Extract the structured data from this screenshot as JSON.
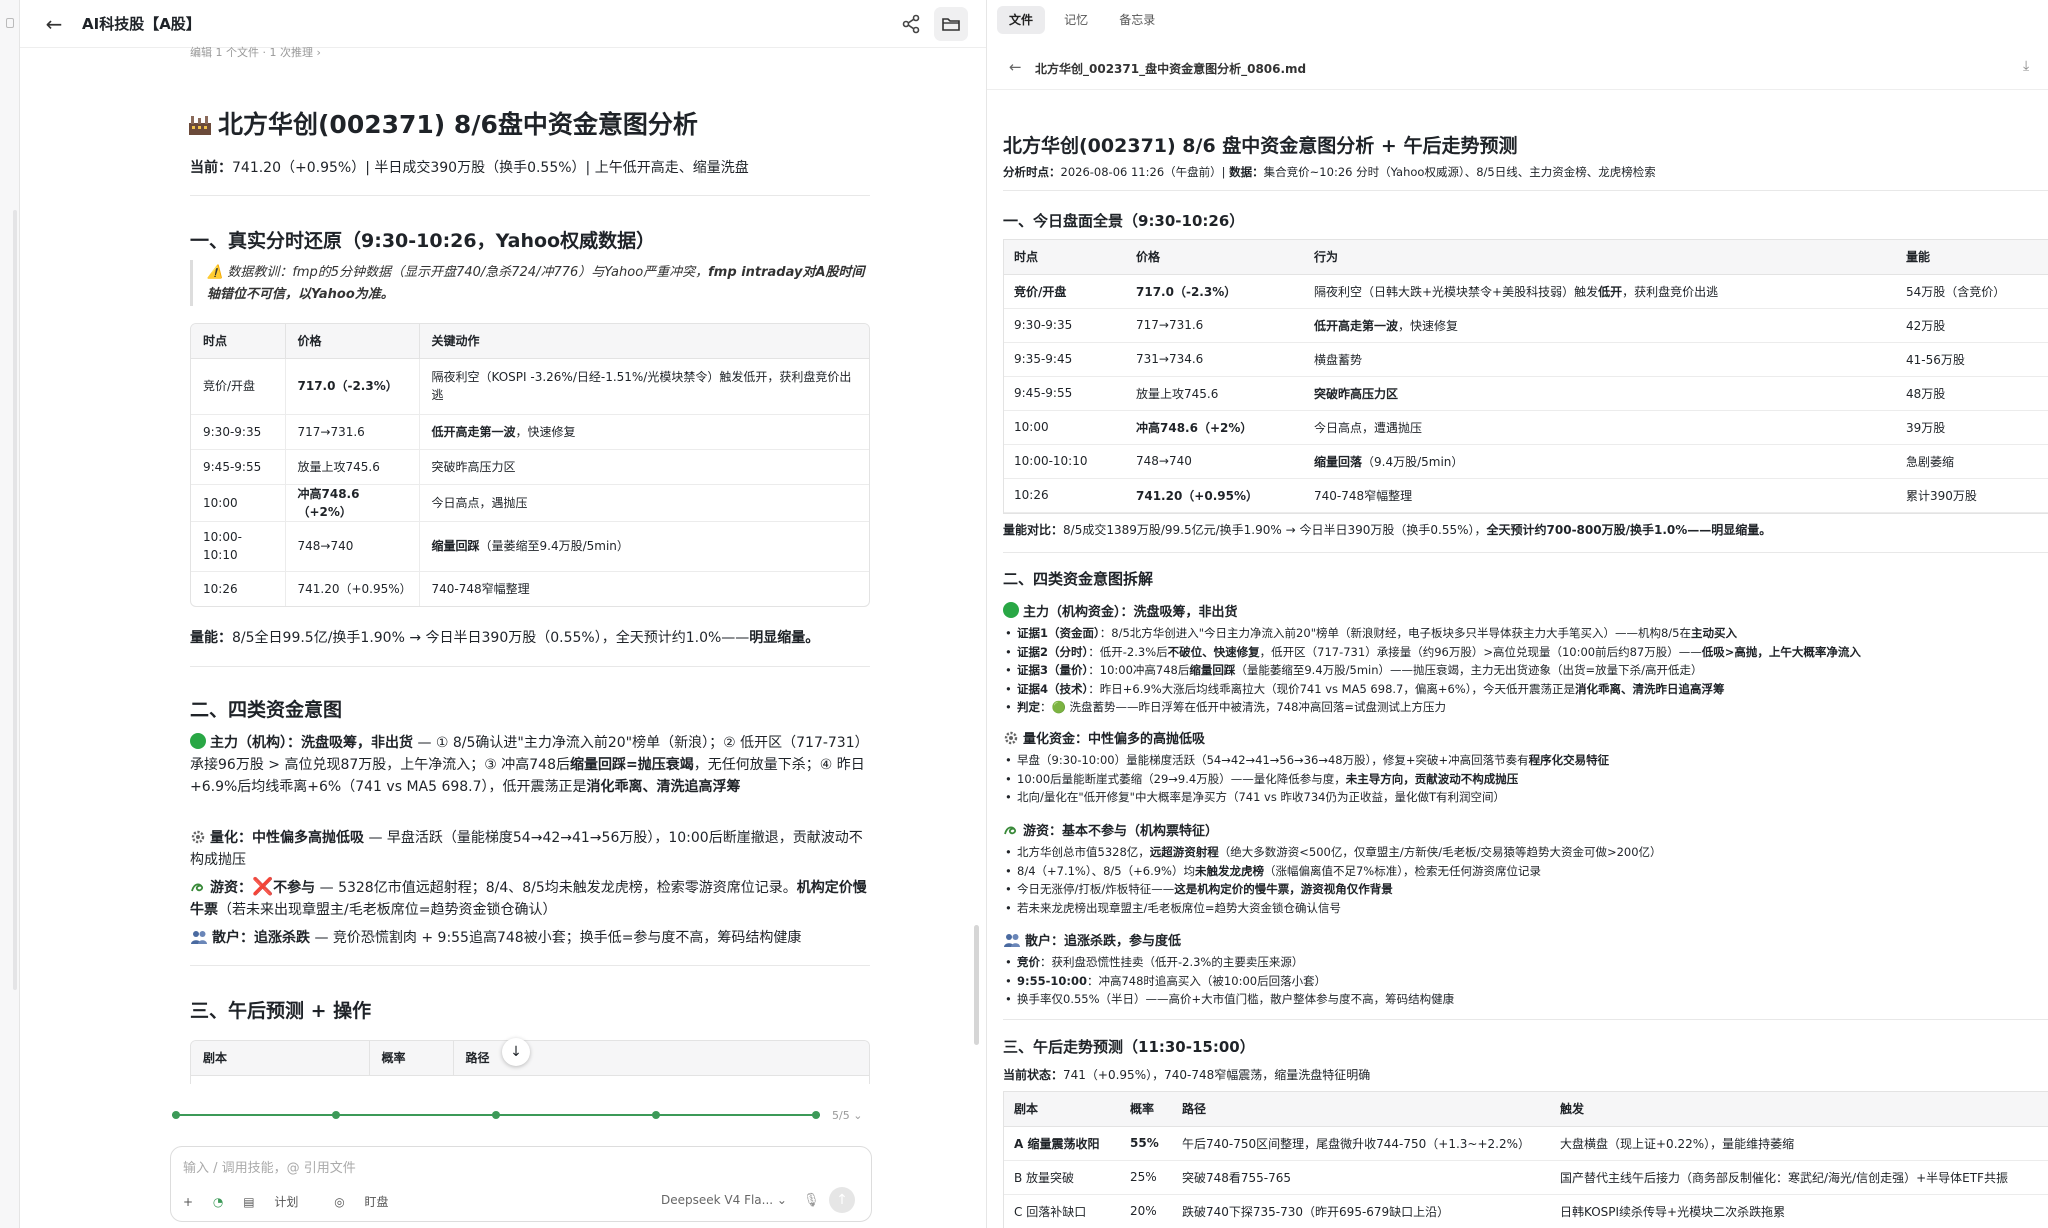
{
  "left": {
    "title": "AI科技股【A股】",
    "sub_hint": "编辑 1 个文件 · 1 次推理  ›",
    "doc_title": "北方华创(002371) 8/6盘中资金意图分析",
    "price_line": {
      "label": "当前：",
      "text": "741.20（+0.95%）| 半日成交390万股（换手0.55%）| 上午低开高走、缩量洗盘"
    },
    "h_section1": "一、真实分时还原（9:30-10:26，Yahoo权威数据）",
    "quote": "⚠️ 数据教训：fmp的5分钟数据（显示开盘740/急杀724/冲776）与Yahoo严重冲突，",
    "quote_bold": "fmp intraday对A股时间轴错位不可信，以Yahoo为准。",
    "table1": {
      "headers": [
        "时点",
        "价格",
        "关键动作"
      ],
      "rows": [
        {
          "t": "竞价/开盘",
          "p": "717.0（-2.3%）",
          "pb": true,
          "a": "隔夜利空（KOSPI -3.26%/日经-1.51%/光模块禁令）触发低开，获利盘竞价出逃",
          "ab": ""
        },
        {
          "t": "9:30-9:35",
          "p": "717→731.6",
          "pb": false,
          "a": "",
          "ab": "低开高走第一波",
          "a2": "，快速修复"
        },
        {
          "t": "9:45-9:55",
          "p": "放量上攻745.6",
          "pb": false,
          "a": "突破昨高压力区",
          "ab": ""
        },
        {
          "t": "10:00",
          "p": "冲高748.6（+2%）",
          "pb": true,
          "a": "今日高点，遇抛压",
          "ab": ""
        },
        {
          "t": "10:00-10:10",
          "p": "748→740",
          "pb": false,
          "a": "",
          "ab": "缩量回踩",
          "a2": "（量萎缩至9.4万股/5min）"
        },
        {
          "t": "10:26",
          "p": "741.20（+0.95%）",
          "pb": false,
          "a": "740-748窄幅整理",
          "ab": ""
        }
      ]
    },
    "vol_line": {
      "label": "量能：",
      "text": "8/5全日99.5亿/换手1.90% → 今日半日390万股（0.55%），全天预计约1.0%——",
      "bold": "明显缩量。"
    },
    "h_section2": "二、四类资金意图",
    "p_main": {
      "lead": "主力（机构）：洗盘吸筹，非出货",
      "t1": " — ① 8/5确认进\"主力净流入前20\"榜单（新浪）；② 低开区（717-731）承接96万股 > 高位兑现87万股，上午净流入；③ 冲高748后",
      "b1": "缩量回踩=抛压衰竭",
      "t2": "，无任何放量下杀；④ 昨日+6.9%后均线乖离+6%（741 vs MA5 698.7），低开震荡正是",
      "b2": "消化乖离、清洗追高浮筹"
    },
    "p_quant": {
      "lead": "量化：中性偏多高抛低吸",
      "t1": " — 早盘活跃（量能梯度54→42→41→56万股），10:00后断崖撤退，贡献波动不构成抛压"
    },
    "p_hot": {
      "lead": "游资：",
      "x": "❌",
      "lead2": "不参与",
      "t1": " — 5328亿市值远超射程；8/4、8/5均未触发龙虎榜，检索零游资席位记录。",
      "b1": "机构定价慢牛票",
      "t2": "（若未来出现章盟主/毛老板席位=趋势资金锁仓确认）"
    },
    "p_retail": {
      "lead": "散户：追涨杀跌",
      "t1": " — 竞价恐慌割肉 + 9:55追高748被小套；换手低=参与度不高，筹码结构健康"
    },
    "h_section3": "三、午后预测 + 操作",
    "table2_headers": [
      "剧本",
      "概率",
      "路径"
    ],
    "progress_label": "5/5",
    "input_placeholder": "输入 / 调用技能，@ 引用文件",
    "tool_plus": "+",
    "tool_plan": "计划",
    "tool_watch": "盯盘",
    "model": "Deepseek V4 Fla... ⌄",
    "mic": "🎙",
    "send": "↑"
  },
  "right": {
    "tabs": [
      "文件",
      "记忆",
      "备忘录"
    ],
    "filename": "北方华创_002371_盘中资金意图分析_0806.md",
    "title": "北方华创(002371) 8/6 盘中资金意图分析 + 午后走势预测",
    "meta_label1": "分析时点：",
    "meta_text1": "2026-08-06 11:26（午盘前）|",
    "meta_label2": "数据：",
    "meta_text2": "集合竞价~10:26 分时（Yahoo权威源）、8/5日线、主力资金榜、龙虎榜检索",
    "h1": "一、今日盘面全景（9:30-10:26）",
    "table1": {
      "headers": [
        "时点",
        "价格",
        "行为",
        "量能"
      ],
      "rows": [
        {
          "t": "竞价/开盘",
          "p": "717.0（-2.3%）",
          "a": "隔夜利空（日韩大跌+光模块禁令+美股科技弱）触发",
          "ab": "低开",
          "a2": "，获利盘竞价出逃",
          "v": "54万股（含竞价）",
          "tb": true,
          "pb": true
        },
        {
          "t": "9:30-9:35",
          "p": "717→731.6",
          "a": "",
          "ab": "低开高走第一波",
          "a2": "，快速修复",
          "v": "42万股"
        },
        {
          "t": "9:35-9:45",
          "p": "731→734.6",
          "a": "横盘蓄势",
          "ab": "",
          "a2": "",
          "v": "41-56万股"
        },
        {
          "t": "9:45-9:55",
          "p": "放量上攻745.6",
          "a": "",
          "ab": "突破昨高压力区",
          "a2": "",
          "v": "48万股"
        },
        {
          "t": "10:00",
          "p": "冲高748.6（+2%）",
          "a": "今日高点，遭遇抛压",
          "ab": "",
          "a2": "",
          "v": "39万股",
          "pb": true
        },
        {
          "t": "10:00-10:10",
          "p": "748→740",
          "a": "",
          "ab": "缩量回落",
          "a2": "（9.4万股/5min）",
          "v": "急剧萎缩"
        },
        {
          "t": "10:26",
          "p": "741.20（+0.95%）",
          "a": "740-748窄幅整理",
          "ab": "",
          "a2": "",
          "v": "累计390万股",
          "pb": true
        }
      ]
    },
    "vol_label": "量能对比：",
    "vol_text": "8/5成交1389万股/99.5亿元/换手1.90% → 今日半日390万股（换手0.55%），",
    "vol_bold": "全天预计约700-800万股/换手1.0%——明显缩量。",
    "h2": "二、四类资金意图拆解",
    "main_head": "主力（机构资金）：洗盘吸筹，非出货",
    "main_items": [
      {
        "l": "证据1（资金面）",
        "t": "：8/5北方华创进入\"今日主力净流入前20\"榜单（新浪财经，电子板块多只半导体获主力大手笔买入）——机构8/5在",
        "b": "主动买入"
      },
      {
        "l": "证据2（分时）",
        "t": "：低开-2.3%后",
        "b": "不破位、快速修复",
        "t2": "，低开区（717-731）承接量（约96万股）>高位兑现量（10:00前后约87万股）——",
        "b2": "低吸>高抛，上午大概率净流入"
      },
      {
        "l": "证据3（量价）",
        "t": "：10:00冲高748后",
        "b": "缩量回踩",
        "t2": "（量能萎缩至9.4万股/5min）——抛压衰竭，主力无出货迹象（出货=放量下杀/高开低走）"
      },
      {
        "l": "证据4（技术）",
        "t": "：昨日+6.9%大涨后均线乖离拉大（现价741 vs MA5 698.7，偏离+6%），今天低开震荡正是",
        "b": "消化乖离、清洗昨日追高浮筹"
      },
      {
        "l": "判定",
        "t": "：🟢 洗盘蓄势——昨日浮筹在低开中被清洗，748冲高回落=试盘测试上方压力"
      }
    ],
    "quant_head": "量化资金：中性偏多的高抛低吸",
    "quant_items": [
      {
        "t": "早盘（9:30-10:00）量能梯度活跃（54→42→41→56→36→48万股），修复+突破+冲高回落节奏有",
        "b": "程序化交易特征"
      },
      {
        "t": "10:00后量能断崖式萎缩（29→9.4万股）——量化降低参与度，",
        "b": "未主导方向，贡献波动不构成抛压"
      },
      {
        "t": "北向/量化在\"低开修复\"中大概率是净买方（741 vs 昨收734仍为正收益，量化做T有利润空间）",
        "b": ""
      }
    ],
    "hot_head": "游资：基本不参与（机构票特征）",
    "hot_items": [
      {
        "t": "北方华创总市值5328亿，",
        "b": "远超游资射程",
        "t2": "（绝大多数游资<500亿，仅章盟主/方新侠/毛老板/交易猿等趋势大资金可做>200亿）"
      },
      {
        "t": "8/4（+7.1%）、8/5（+6.9%）均",
        "b": "未触发龙虎榜",
        "t2": "（涨幅偏离值不足7%标准），检索无任何游资席位记录"
      },
      {
        "t": "今日无涨停/打板/炸板特征——",
        "b": "这是机构定价的慢牛票，游资视角仅作背景",
        "t2": ""
      },
      {
        "t": "若未来龙虎榜出现章盟主/毛老板席位=趋势大资金锁仓确认信号",
        "b": "",
        "t2": ""
      }
    ],
    "retail_head": "散户：追涨杀跌，参与度低",
    "retail_items": [
      {
        "l": "竞价",
        "t": "：获利盘恐慌性挂卖（低开-2.3%的主要卖压来源）"
      },
      {
        "l": "9:55-10:00",
        "t": "：冲高748时追高买入（被10:00后回落小套）"
      },
      {
        "l": "",
        "t": "换手率仅0.55%（半日）——高价+大市值门槛，散户整体参与度不高，筹码结构健康"
      }
    ],
    "h3": "三、午后走势预测（11:30-15:00）",
    "state_label": "当前状态：",
    "state_text": "741（+0.95%），740-748窄幅震荡，缩量洗盘特征明确",
    "table2": {
      "headers": [
        "剧本",
        "概率",
        "路径",
        "触发"
      ],
      "rows": [
        {
          "s": "A 缩量震荡收阳",
          "p": "55%",
          "r": "午后740-750区间整理，尾盘微升收744-750（+1.3~+2.2%）",
          "tr": "大盘横盘（现上证+0.22%），量能维持萎缩",
          "bold": true
        },
        {
          "s": "B 放量突破",
          "p": "25%",
          "r": "突破748看755-765",
          "tr": "国产替代主线午后接力（商务部反制催化：寒武纪/海光/信创走强）+半导体ETF共振",
          "bold": false
        },
        {
          "s": "C 回落补缺口",
          "p": "20%",
          "r": "跌破740下探735-730（昨开695-679缺口上沿）",
          "tr": "日韩KOSPI续杀传导+光模块二次杀跌拖累",
          "bold": false
        }
      ]
    }
  }
}
